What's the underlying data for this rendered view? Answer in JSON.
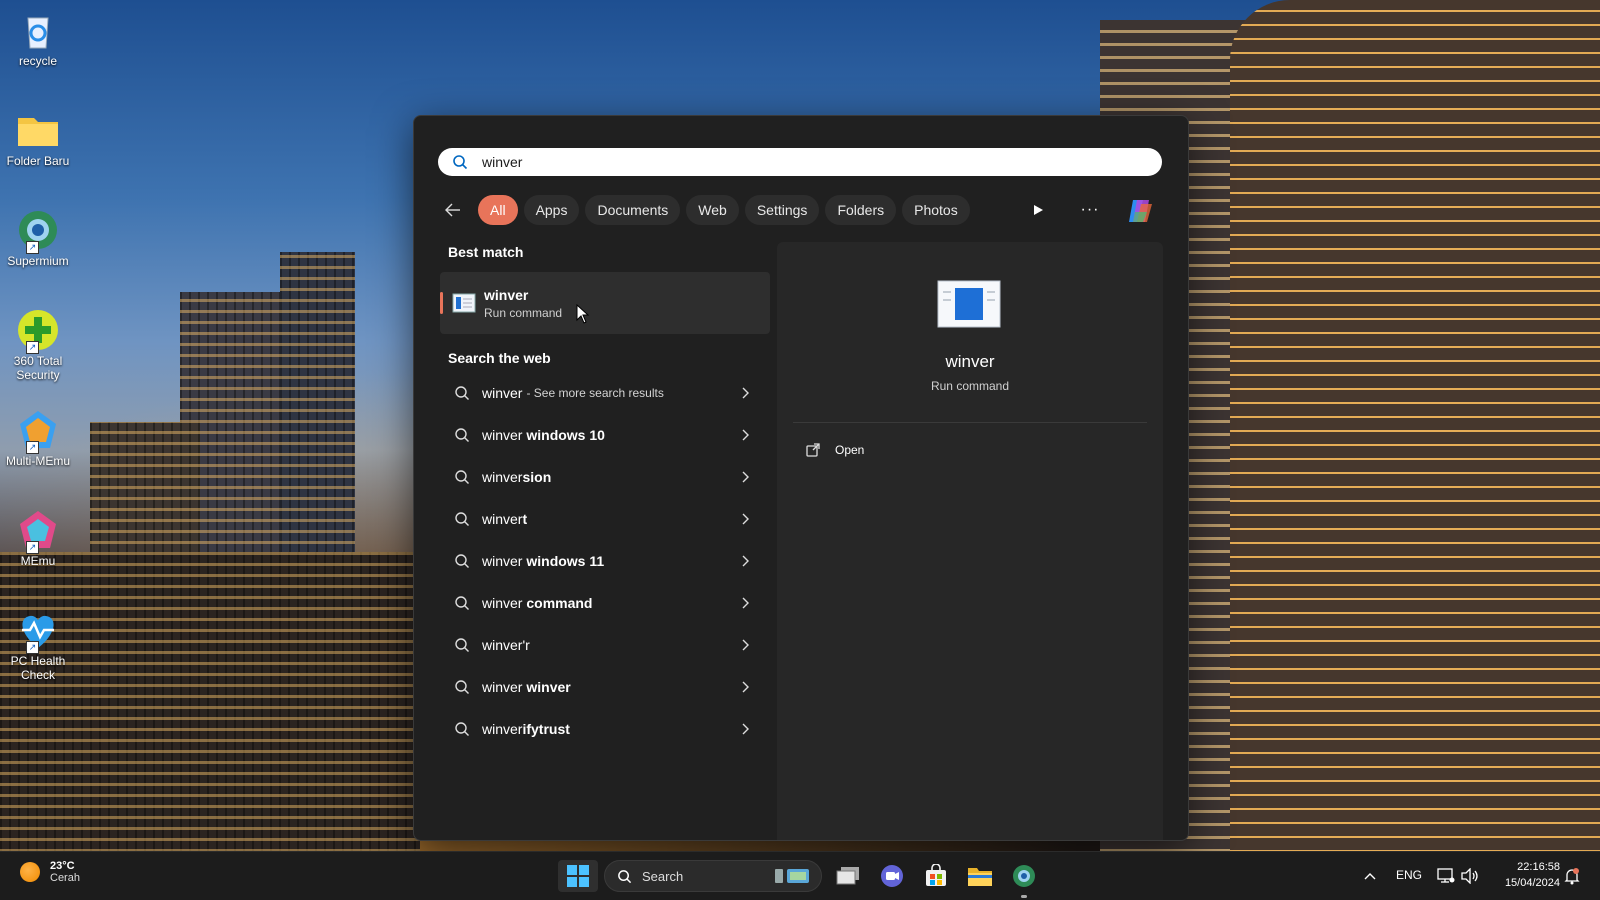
{
  "desktop": {
    "icons": [
      {
        "label": "recycle",
        "icon": "recycle-bin-icon"
      },
      {
        "label": "Folder Baru",
        "icon": "folder-icon"
      },
      {
        "label": "Supermium",
        "icon": "supermium-browser-icon"
      },
      {
        "label": "360 Total Security",
        "icon": "360-security-icon"
      },
      {
        "label": "Multi-MEmu",
        "icon": "multi-memu-icon"
      },
      {
        "label": "MEmu",
        "icon": "memu-icon"
      },
      {
        "label": "PC Health Check",
        "icon": "pc-health-check-icon"
      }
    ]
  },
  "search": {
    "query": "winver",
    "filters": [
      "All",
      "Apps",
      "Documents",
      "Web",
      "Settings",
      "Folders",
      "Photos"
    ],
    "active_filter": "All"
  },
  "best_match": {
    "section_label": "Best match",
    "title": "winver",
    "subtitle": "Run command"
  },
  "web": {
    "section_label": "Search the web",
    "suggestions": [
      {
        "prefix": "winver",
        "bold": "",
        "extra": "- See more search results"
      },
      {
        "prefix": "winver",
        "bold": " windows 10",
        "extra": ""
      },
      {
        "prefix": "winver",
        "bold": "sion",
        "extra": ""
      },
      {
        "prefix": "winver",
        "bold": "t",
        "extra": ""
      },
      {
        "prefix": "winver",
        "bold": " windows 11",
        "extra": ""
      },
      {
        "prefix": "winver",
        "bold": " command",
        "extra": ""
      },
      {
        "prefix": "winver'r",
        "bold": "",
        "extra": ""
      },
      {
        "prefix": "winver",
        "bold": " winver",
        "extra": ""
      },
      {
        "prefix": "winver",
        "bold": "ifytrust",
        "extra": ""
      }
    ]
  },
  "preview": {
    "title": "winver",
    "subtitle": "Run command",
    "action_open": "Open"
  },
  "taskbar": {
    "weather_temp": "23°C",
    "weather_desc": "Cerah",
    "search_label": "Search",
    "language": "ENG",
    "time": "22:16:58",
    "date": "15/04/2024"
  },
  "colors": {
    "accent": "#e8745a",
    "panel_bg": "#202020",
    "preview_bg": "#272727"
  }
}
